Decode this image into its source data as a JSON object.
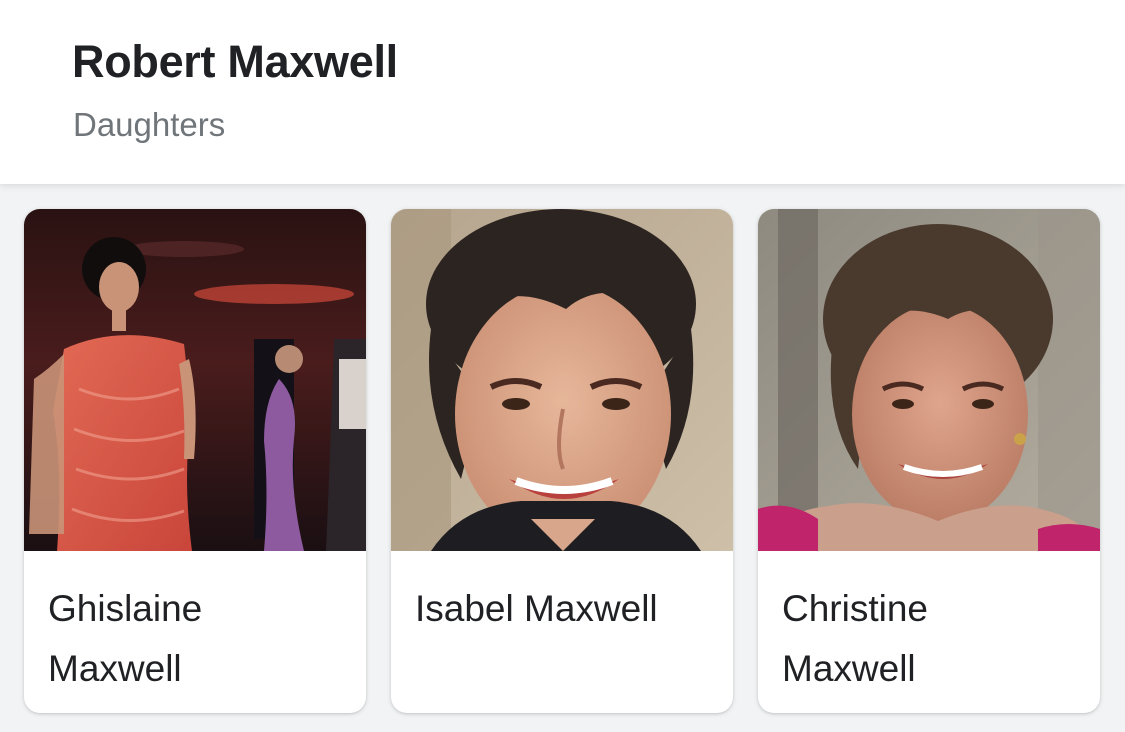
{
  "header": {
    "title": "Robert Maxwell",
    "subtitle": "Daughters"
  },
  "cards": [
    {
      "name_line1": "Ghislaine",
      "name_line2": "Maxwell"
    },
    {
      "name_line1": "Isabel Maxwell",
      "name_line2": ""
    },
    {
      "name_line1": "Christine",
      "name_line2": "Maxwell"
    }
  ],
  "colors": {
    "page_background": "#f1f3f4",
    "card_background": "#ffffff",
    "title_text": "#202124",
    "subtitle_text": "#70757a"
  }
}
